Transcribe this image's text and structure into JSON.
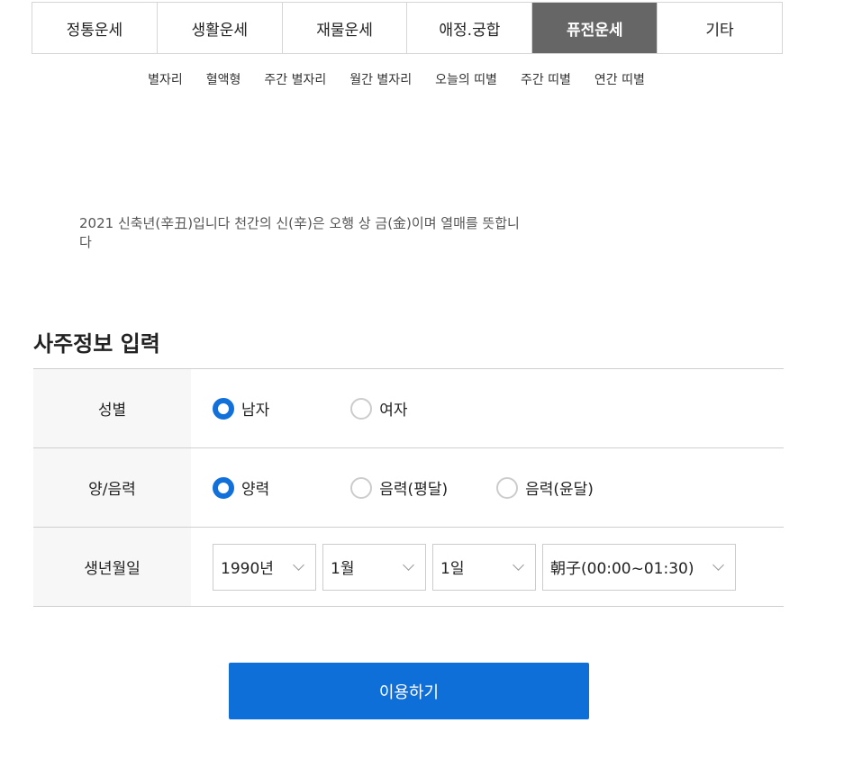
{
  "main_tabs": [
    {
      "label": "정통운세"
    },
    {
      "label": "생활운세"
    },
    {
      "label": "재물운세"
    },
    {
      "label": "애정.궁합"
    },
    {
      "label": "퓨전운세",
      "active": true
    },
    {
      "label": "기타"
    }
  ],
  "sub_tabs": [
    "별자리",
    "혈액형",
    "주간 별자리",
    "월간 별자리",
    "오늘의 띠별",
    "주간 띠별",
    "연간 띠별"
  ],
  "description": "2021 신축년(辛丑)입니다 천간의 신(辛)은 오행 상 금(金)이며 열매를 뜻합니다",
  "section_title": "사주정보 입력",
  "form": {
    "gender": {
      "label": "성별",
      "options": [
        "남자",
        "여자"
      ],
      "selected": "남자"
    },
    "calendar": {
      "label": "양/음력",
      "options": [
        "양력",
        "음력(평달)",
        "음력(윤달)"
      ],
      "selected": "양력"
    },
    "birth": {
      "label": "생년월일",
      "year": "1990년",
      "month": "1월",
      "day": "1일",
      "time": "朝子(00:00~01:30)"
    }
  },
  "submit_label": "이용하기",
  "colors": {
    "active_tab_bg": "#666666",
    "primary": "#0f6fd8",
    "radio_checked": "#1270db"
  }
}
